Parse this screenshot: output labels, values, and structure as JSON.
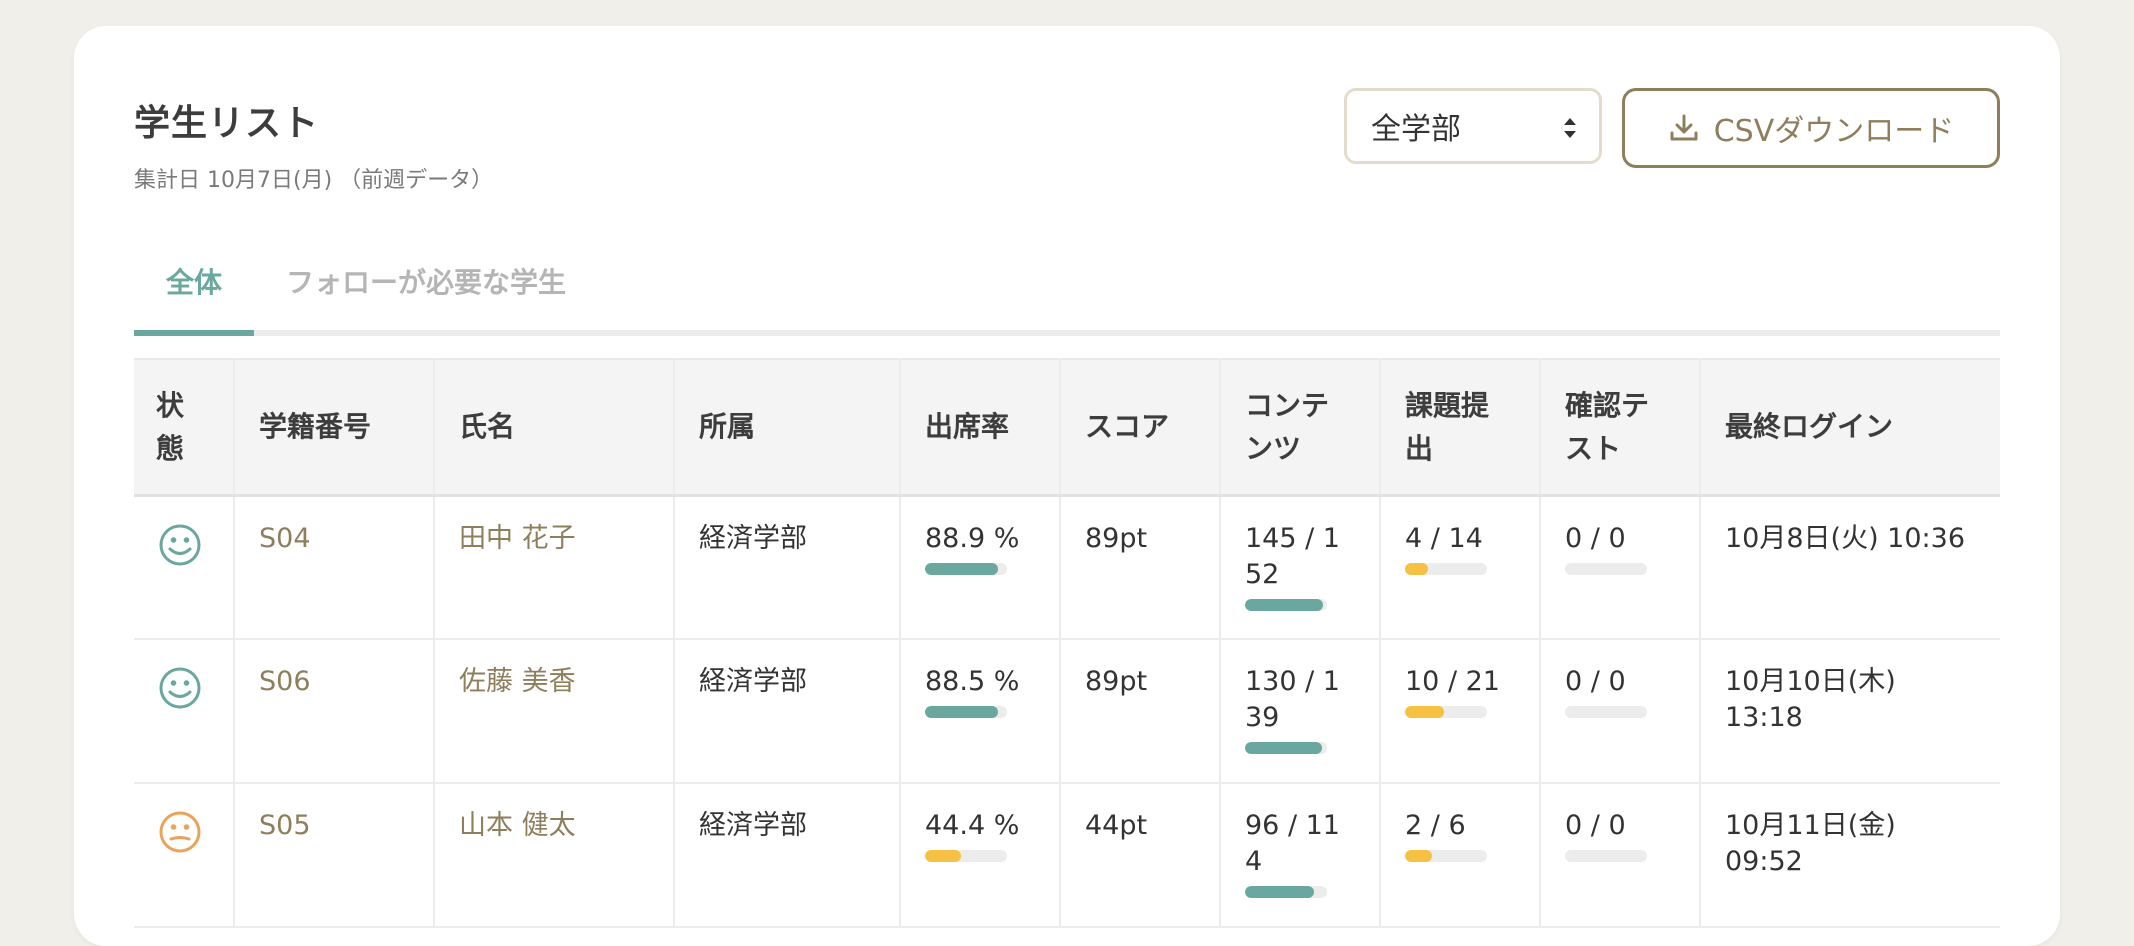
{
  "header": {
    "title": "学生リスト",
    "subtitle": "集計日 10月7日(月) （前週データ）",
    "filter_value": "全学部",
    "csv_label": "CSVダウンロード"
  },
  "tabs": [
    {
      "label": "全体",
      "active": true
    },
    {
      "label": "フォローが必要な学生",
      "active": false
    }
  ],
  "table": {
    "headers": [
      "状態",
      "学籍番号",
      "氏名",
      "所属",
      "出席率",
      "スコア",
      "コンテンツ",
      "課題提出",
      "確認テスト",
      "最終ログイン"
    ],
    "rows": [
      {
        "status": "happy",
        "id": "S04",
        "name": "田中 花子",
        "dept": "経済学部",
        "attendance": "88.9 %",
        "attendance_pct": 88.9,
        "score": "89pt",
        "content": "145 / 152",
        "content_pct": 95.4,
        "assign": "4 / 14",
        "assign_pct": 28.6,
        "test": "0 / 0",
        "test_pct": 0,
        "last_login": "10月8日(火) 10:36"
      },
      {
        "status": "happy",
        "id": "S06",
        "name": "佐藤 美香",
        "dept": "経済学部",
        "attendance": "88.5 %",
        "attendance_pct": 88.5,
        "score": "89pt",
        "content": "130 / 139",
        "content_pct": 93.5,
        "assign": "10 / 21",
        "assign_pct": 47.6,
        "test": "0 / 0",
        "test_pct": 0,
        "last_login": "10月10日(木) 13:18"
      },
      {
        "status": "neutral",
        "id": "S05",
        "name": "山本 健太",
        "dept": "経済学部",
        "attendance": "44.4 %",
        "attendance_pct": 44.4,
        "score": "44pt",
        "content": "96 / 114",
        "content_pct": 84.2,
        "assign": "2 / 6",
        "assign_pct": 33.3,
        "test": "0 / 0",
        "test_pct": 0,
        "last_login": "10月11日(金) 09:52"
      }
    ]
  },
  "colors": {
    "accent": "#6aa89f",
    "link": "#8e7e5c",
    "warn": "#f6c142",
    "neutral_face": "#eba25a",
    "bar_track": "#ececec"
  },
  "icons": {
    "download": "download-icon",
    "sort": "sort-arrows-icon",
    "happy": "smiley-face-icon",
    "neutral": "neutral-face-icon"
  }
}
